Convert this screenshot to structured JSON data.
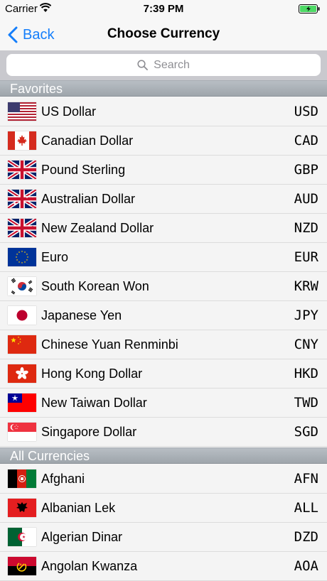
{
  "status": {
    "carrier": "Carrier",
    "time": "7:39 PM"
  },
  "nav": {
    "back_label": "Back",
    "title": "Choose Currency"
  },
  "search": {
    "placeholder": "Search"
  },
  "sections": {
    "favorites": "Favorites",
    "all": "All Currencies"
  },
  "favorites": [
    {
      "name": "US Dollar",
      "code": "USD",
      "flag": "us-flag-icon"
    },
    {
      "name": "Canadian Dollar",
      "code": "CAD",
      "flag": "canada-flag-icon"
    },
    {
      "name": "Pound Sterling",
      "code": "GBP",
      "flag": "uk-flag-icon"
    },
    {
      "name": "Australian Dollar",
      "code": "AUD",
      "flag": "australia-flag-icon"
    },
    {
      "name": "New Zealand Dollar",
      "code": "NZD",
      "flag": "new-zealand-flag-icon"
    },
    {
      "name": "Euro",
      "code": "EUR",
      "flag": "eu-flag-icon"
    },
    {
      "name": "South Korean Won",
      "code": "KRW",
      "flag": "south-korea-flag-icon"
    },
    {
      "name": "Japanese Yen",
      "code": "JPY",
      "flag": "japan-flag-icon"
    },
    {
      "name": "Chinese Yuan Renminbi",
      "code": "CNY",
      "flag": "china-flag-icon"
    },
    {
      "name": "Hong Kong Dollar",
      "code": "HKD",
      "flag": "hong-kong-flag-icon"
    },
    {
      "name": "New Taiwan Dollar",
      "code": "TWD",
      "flag": "taiwan-flag-icon"
    },
    {
      "name": "Singapore Dollar",
      "code": "SGD",
      "flag": "singapore-flag-icon"
    }
  ],
  "all_currencies": [
    {
      "name": "Afghani",
      "code": "AFN",
      "flag": "afghanistan-flag-icon"
    },
    {
      "name": "Albanian Lek",
      "code": "ALL",
      "flag": "albania-flag-icon"
    },
    {
      "name": "Algerian Dinar",
      "code": "DZD",
      "flag": "algeria-flag-icon"
    },
    {
      "name": "Angolan Kwanza",
      "code": "AOA",
      "flag": "angola-flag-icon"
    }
  ],
  "colors": {
    "accent": "#147efb",
    "battery": "#4cd964"
  }
}
